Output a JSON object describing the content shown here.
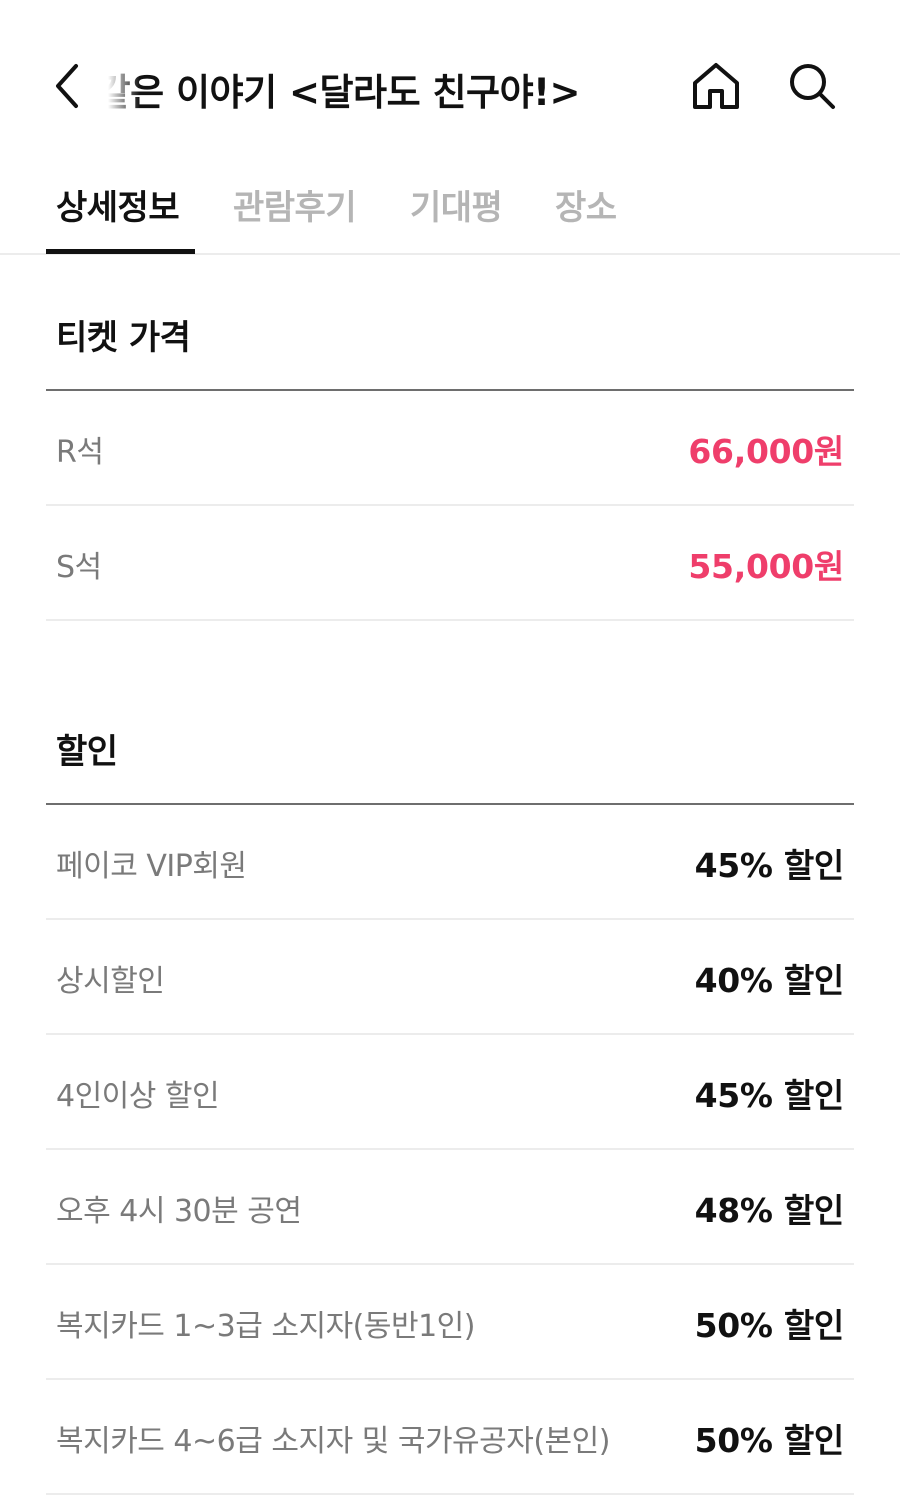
{
  "header": {
    "title": "같은 이야기 <달라도 친구야!>",
    "back_icon": "chevron-left-icon",
    "home_icon": "home-icon",
    "search_icon": "search-icon"
  },
  "tabs": [
    {
      "label": "상세정보",
      "active": true
    },
    {
      "label": "관람후기",
      "active": false
    },
    {
      "label": "기대평",
      "active": false
    },
    {
      "label": "장소",
      "active": false
    }
  ],
  "ticket_price": {
    "title": "티켓 가격",
    "rows": [
      {
        "label": "R석",
        "value": "66,000원"
      },
      {
        "label": "S석",
        "value": "55,000원"
      }
    ]
  },
  "discount": {
    "title": "할인",
    "rows": [
      {
        "label": "페이코 VIP회원",
        "value": "45% 할인"
      },
      {
        "label": "상시할인",
        "value": "40% 할인"
      },
      {
        "label": "4인이상 할인",
        "value": "45% 할인"
      },
      {
        "label": "오후 4시 30분 공연",
        "value": "48% 할인"
      },
      {
        "label": "복지카드 1~3급 소지자(동반1인)",
        "value": "50% 할인"
      },
      {
        "label": "복지카드 4~6급 소지자 및 국가유공자(본인)",
        "value": "50% 할인"
      }
    ]
  },
  "colors": {
    "price": "#ef3e6b",
    "tab_active": "#111111",
    "tab_inactive": "#b5b5b5"
  }
}
